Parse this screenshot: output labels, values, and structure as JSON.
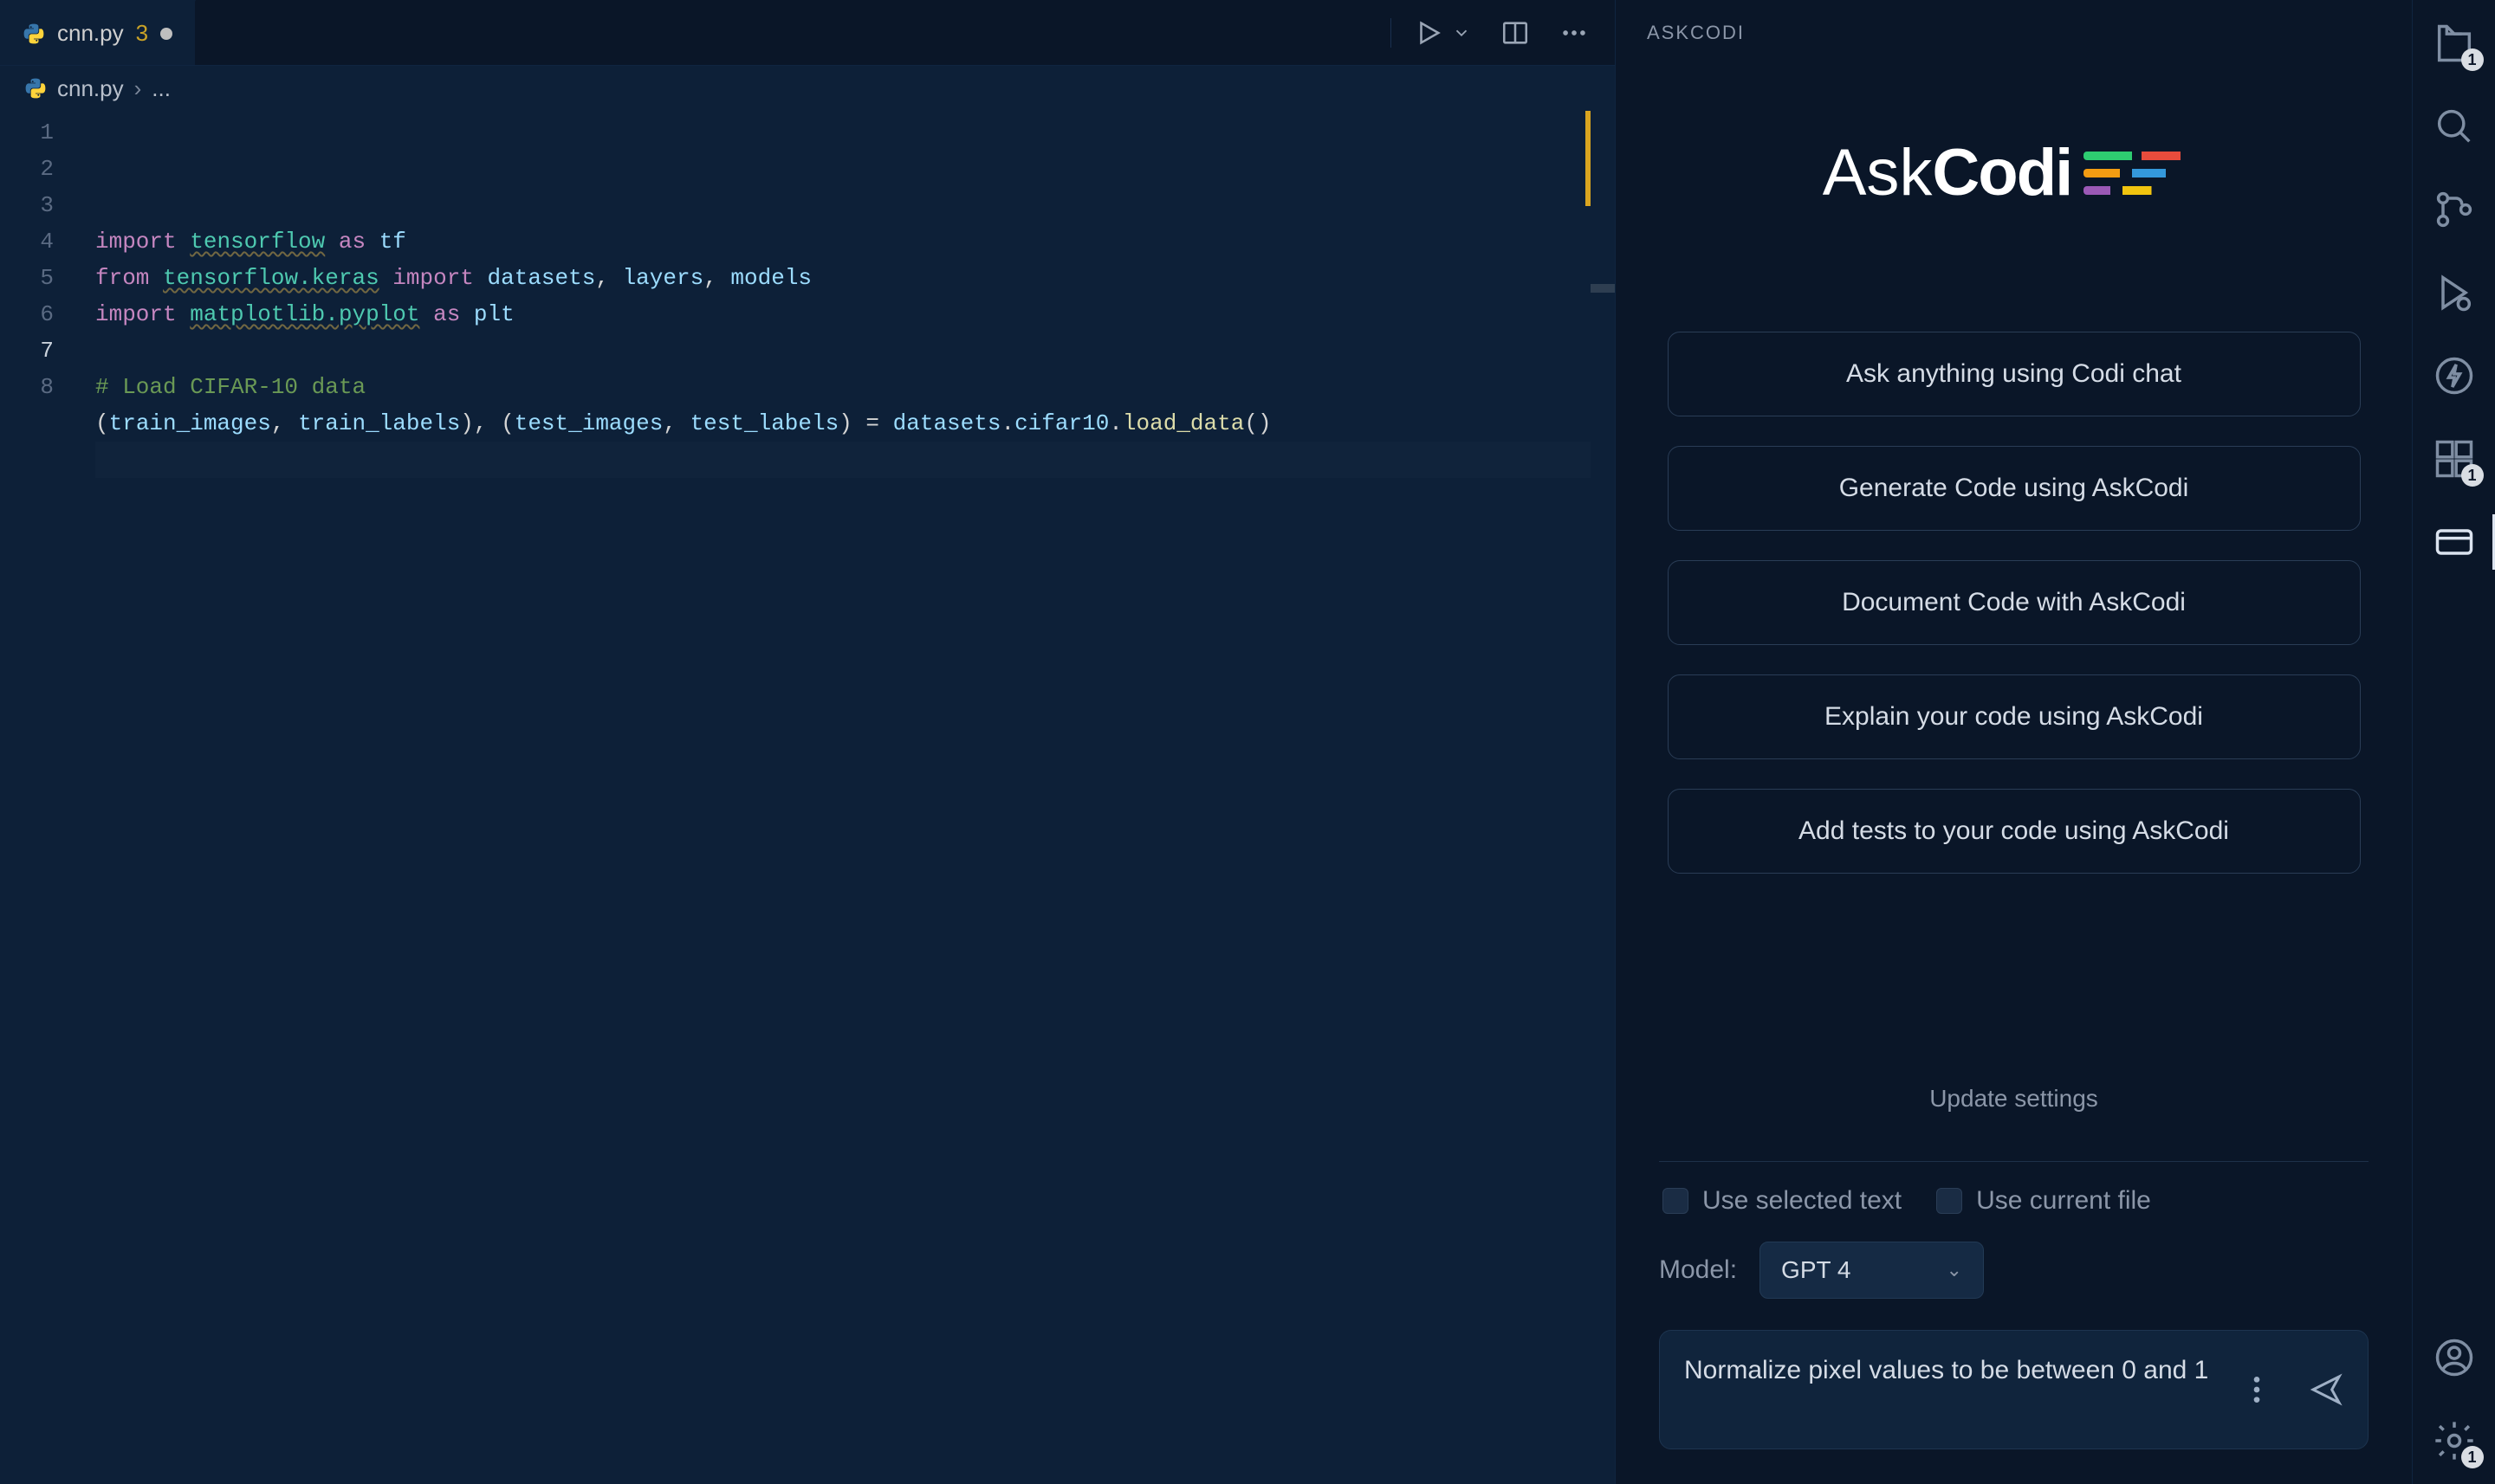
{
  "tabs": [
    {
      "name": "cnn.py",
      "badge": "3",
      "dirty": true
    }
  ],
  "breadcrumb": {
    "file": "cnn.py",
    "rest": "..."
  },
  "code": {
    "lines": [
      {
        "n": 1,
        "tokens": [
          {
            "c": "kw",
            "t": "import"
          },
          {
            "c": "punc",
            "t": " "
          },
          {
            "c": "mod",
            "t": "tensorflow"
          },
          {
            "c": "punc",
            "t": " "
          },
          {
            "c": "kw",
            "t": "as"
          },
          {
            "c": "punc",
            "t": " "
          },
          {
            "c": "alias",
            "t": "tf"
          }
        ]
      },
      {
        "n": 2,
        "tokens": [
          {
            "c": "kw",
            "t": "from"
          },
          {
            "c": "punc",
            "t": " "
          },
          {
            "c": "mod",
            "t": "tensorflow.keras"
          },
          {
            "c": "punc",
            "t": " "
          },
          {
            "c": "kw",
            "t": "import"
          },
          {
            "c": "punc",
            "t": " "
          },
          {
            "c": "id",
            "t": "datasets"
          },
          {
            "c": "punc",
            "t": ", "
          },
          {
            "c": "id",
            "t": "layers"
          },
          {
            "c": "punc",
            "t": ", "
          },
          {
            "c": "id",
            "t": "models"
          }
        ]
      },
      {
        "n": 3,
        "tokens": [
          {
            "c": "kw",
            "t": "import"
          },
          {
            "c": "punc",
            "t": " "
          },
          {
            "c": "mod",
            "t": "matplotlib.pyplot"
          },
          {
            "c": "punc",
            "t": " "
          },
          {
            "c": "kw",
            "t": "as"
          },
          {
            "c": "punc",
            "t": " "
          },
          {
            "c": "alias",
            "t": "plt"
          }
        ]
      },
      {
        "n": 4,
        "tokens": []
      },
      {
        "n": 5,
        "tokens": [
          {
            "c": "cmt",
            "t": "# Load CIFAR-10 data"
          }
        ]
      },
      {
        "n": 6,
        "tokens": [
          {
            "c": "punc",
            "t": "("
          },
          {
            "c": "var",
            "t": "train_images"
          },
          {
            "c": "punc",
            "t": ", "
          },
          {
            "c": "var",
            "t": "train_labels"
          },
          {
            "c": "punc",
            "t": "), ("
          },
          {
            "c": "var",
            "t": "test_images"
          },
          {
            "c": "punc",
            "t": ", "
          },
          {
            "c": "var",
            "t": "test_labels"
          },
          {
            "c": "punc",
            "t": ") = "
          },
          {
            "c": "id",
            "t": "datasets"
          },
          {
            "c": "punc",
            "t": "."
          },
          {
            "c": "id",
            "t": "cifar10"
          },
          {
            "c": "punc",
            "t": "."
          },
          {
            "c": "fn",
            "t": "load_data"
          },
          {
            "c": "punc",
            "t": "()"
          }
        ]
      },
      {
        "n": 7,
        "tokens": [],
        "current": true
      },
      {
        "n": 8,
        "tokens": []
      }
    ]
  },
  "panel": {
    "title": "ASKCODI",
    "logo": {
      "thin": "Ask",
      "bold": "Codi"
    },
    "actions": [
      "Ask anything using Codi chat",
      "Generate Code using AskCodi",
      "Document Code with AskCodi",
      "Explain your code using AskCodi",
      "Add tests to your code using AskCodi"
    ],
    "update_settings": "Update settings",
    "check_selected": "Use selected text",
    "check_file": "Use current file",
    "model_label": "Model:",
    "model_value": "GPT 4",
    "chat_value": "Normalize pixel values to be between 0 and 1"
  },
  "activity": {
    "explorer_badge": "1",
    "extensions_badge": "1",
    "settings_badge": "1"
  }
}
